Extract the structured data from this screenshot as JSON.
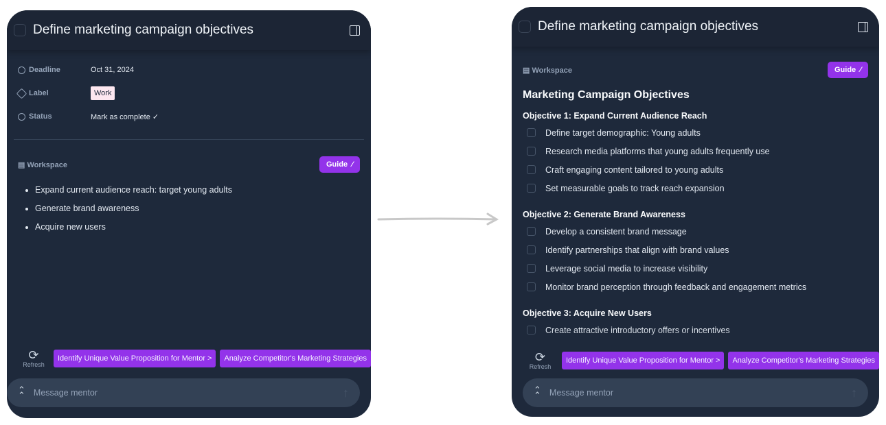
{
  "left": {
    "title": "Define marketing campaign objectives",
    "props": [
      {
        "key": "Deadline",
        "value": "Oct 31, 2024"
      },
      {
        "key": "Label",
        "value": "Work"
      },
      {
        "key": "Status",
        "value": "Mark as complete ✓"
      }
    ],
    "workspace_label": "Workspace",
    "guide_label": "Guide",
    "bullets": [
      "Expand current audience reach: target young adults",
      "Generate brand awareness",
      "Acquire new users"
    ],
    "refresh_label": "Refresh",
    "suggestions": [
      "Identify Unique Value Proposition for Mentor  >",
      "Analyze Competitor's Marketing Strategies"
    ],
    "message_placeholder": "Message mentor"
  },
  "right": {
    "title": "Define marketing campaign objectives",
    "workspace_label": "Workspace",
    "guide_label": "Guide",
    "doc_title": "Marketing Campaign Objectives",
    "objectives": [
      {
        "heading": "Objective 1: Expand Current Audience Reach",
        "items": [
          "Define target demographic: Young adults",
          "Research media platforms that young adults frequently use",
          "Craft engaging content tailored to young adults",
          "Set measurable goals to track reach expansion"
        ]
      },
      {
        "heading": "Objective 2: Generate Brand Awareness",
        "items": [
          "Develop a consistent brand message",
          "Identify partnerships that align with brand values",
          "Leverage social media to increase visibility",
          "Monitor brand perception through feedback and engagement metrics"
        ]
      },
      {
        "heading": "Objective 3: Acquire New Users",
        "items": [
          "Create attractive introductory offers or incentives"
        ]
      }
    ],
    "refresh_label": "Refresh",
    "suggestions": [
      "Identify Unique Value Proposition for Mentor  >",
      "Analyze Competitor's Marketing Strategies"
    ],
    "message_placeholder": "Message mentor"
  },
  "colors": {
    "panel": "#1e293b",
    "accent": "#9333ea",
    "tag": "#fde7f0"
  }
}
